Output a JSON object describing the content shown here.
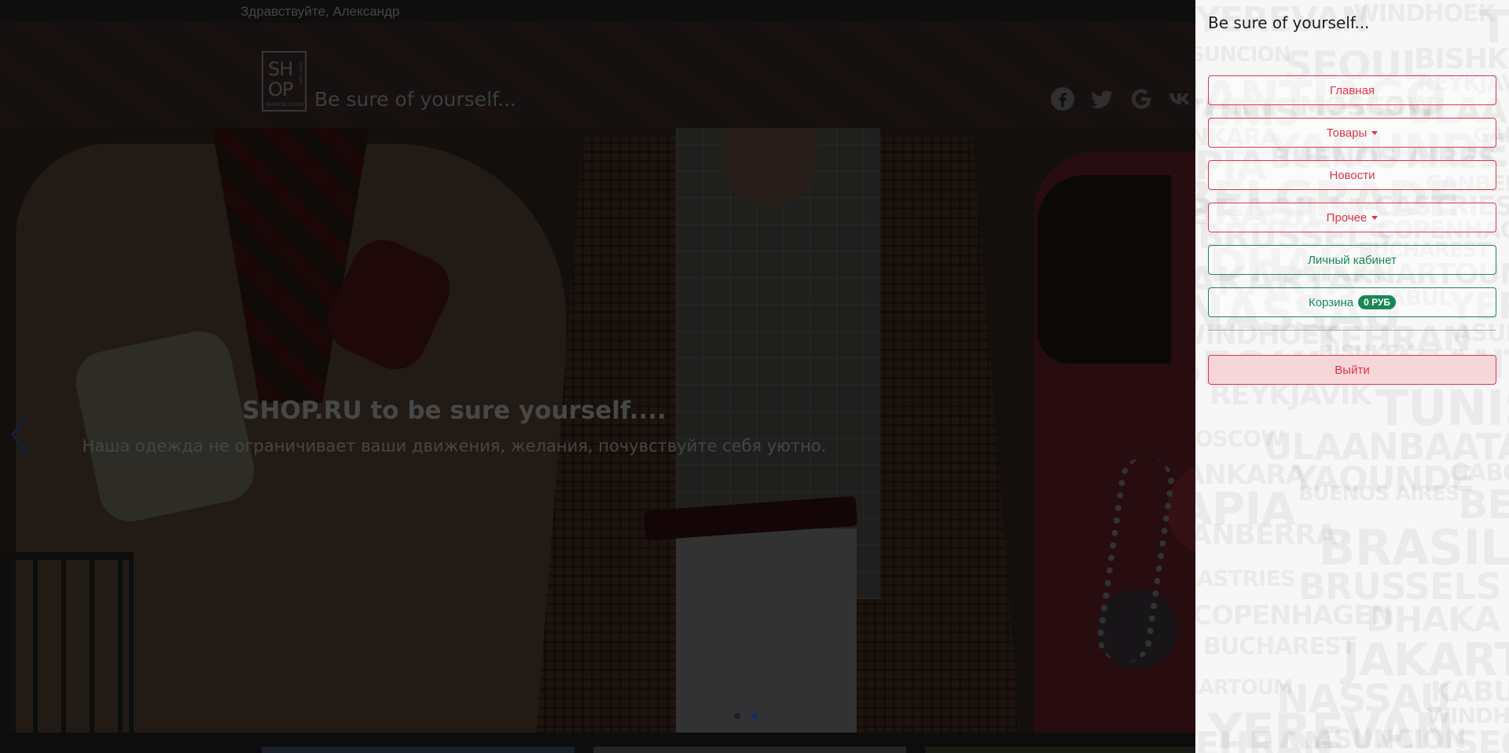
{
  "topbar": {
    "greeting": "Здравствуйте, Александр"
  },
  "header": {
    "logo": {
      "line1": "SH",
      "line2": "OP",
      "sub": "FASHION STORE",
      "side": "Since 2020"
    },
    "tagline": "Be sure of yourself..."
  },
  "social": [
    {
      "name": "facebook-icon"
    },
    {
      "name": "twitter-icon"
    },
    {
      "name": "google-icon"
    },
    {
      "name": "vk-icon"
    }
  ],
  "hero": {
    "title": "SHOP.RU to be sure yourself....",
    "text": "Наша одежда не ограничивает ваши движения, желания, почувствуйте себя уютно.",
    "slides_count": 3,
    "active_slide": 2
  },
  "offcanvas": {
    "title": "Be sure of yourself...",
    "nav": {
      "home": "Главная",
      "products": "Товары",
      "news": "Новости",
      "other": "Прочее",
      "account": "Личный кабинет",
      "cart": "Корзина",
      "cart_badge": "0 РУБ",
      "logout": "Выйти"
    },
    "background_words": [
      "YEREVAN",
      "WINDHOEK",
      "TEHRAN",
      "ASUNCION",
      "SEOUL",
      "BISHKEK",
      "SANTIAGO",
      "REYKJAVIK",
      "TUNIS",
      "MOSCOW",
      "ULAANBAATAR",
      "ANKARA",
      "YAOUNDE",
      "GABORONE",
      "APIA",
      "BUENOS AIRES",
      "BELGRADE",
      "CANBERRA",
      "BRASILIA",
      "CASTRIES",
      "BRUSSELS",
      "COPENHAGEN",
      "DHAKA",
      "BUCHAREST",
      "JAKARTA",
      "KHARTOUM",
      "NASSAU",
      "KABUL"
    ]
  },
  "colors": {
    "danger": "#dc3545",
    "success": "#198754",
    "offcanvas_bg": "#f7f7f7"
  }
}
